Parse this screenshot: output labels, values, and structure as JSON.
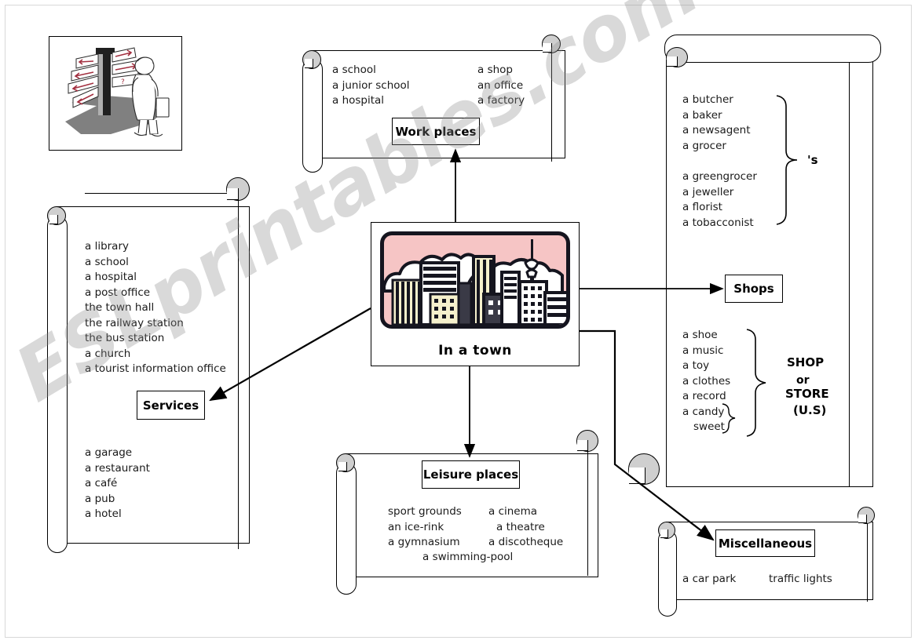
{
  "worksheet": {
    "center": {
      "title": "In a town",
      "image_name": "city-skyline-illustration"
    },
    "signpost": {
      "image_name": "signpost-with-person-illustration"
    },
    "watermark": "ESLprintables.com",
    "categories": {
      "work_places": {
        "label": "Work places",
        "column_left": [
          "a school",
          "a junior school",
          "a hospital"
        ],
        "column_right": [
          "a shop",
          "an office",
          "a factory"
        ]
      },
      "services": {
        "label": "Services",
        "list_top": [
          "a library",
          "a school",
          "a hospital",
          "a post office",
          "the town hall",
          "the railway station",
          "the bus station",
          "a church",
          "a tourist information office"
        ],
        "list_bottom": [
          "a garage",
          "a restaurant",
          "a café",
          "a pub",
          "a hotel"
        ]
      },
      "shops": {
        "label": "Shops",
        "possessive_group_a": [
          "a butcher",
          "a baker",
          "a newsagent",
          "a grocer"
        ],
        "possessive_group_b": [
          "a greengrocer",
          "a jeweller",
          "a florist",
          "a tobacconist"
        ],
        "possessive_note": "'s",
        "store_group": [
          "a shoe",
          "a music",
          "a toy",
          "a clothes",
          "a record",
          "a candy"
        ],
        "store_alt": "sweet",
        "store_note_line1": "SHOP",
        "store_note_line2": "or",
        "store_note_line3": "STORE",
        "store_note_line4": "(U.S)"
      },
      "leisure_places": {
        "label": "Leisure places",
        "column_left": [
          "sport grounds",
          "an ice-rink",
          "a gymnasium"
        ],
        "column_right": [
          "a cinema",
          "a theatre",
          "a discotheque"
        ],
        "centered": "a swimming-pool"
      },
      "miscellaneous": {
        "label": "Miscellaneous",
        "items_left": "a car park",
        "items_right": "traffic lights"
      }
    },
    "colors": {
      "sky": "#f6c5c5",
      "cloud": "#ffffff",
      "building_dark": "#15151f",
      "building_cream": "#f5f0cc",
      "roll_grey": "#cfcfcf",
      "ink": "#000000",
      "watermark": "#8c8c8c"
    }
  }
}
